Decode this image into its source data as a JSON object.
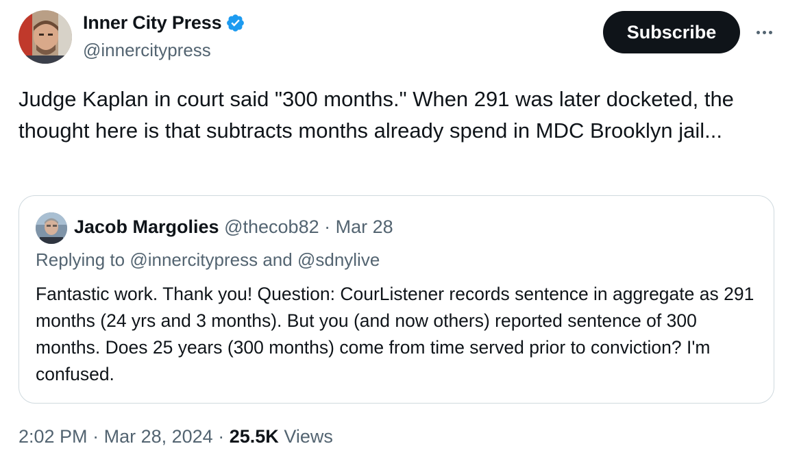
{
  "author": {
    "name": "Inner City Press",
    "handle": "@innercitypress",
    "verified": true
  },
  "actions": {
    "subscribe_label": "Subscribe",
    "more_icon": "more-horizontal-icon"
  },
  "tweet": {
    "text": "Judge Kaplan in court said \"300 months.\" When 291 was later docketed, the thought here is that subtracts months already spend in MDC Brooklyn jail..."
  },
  "quote": {
    "name": "Jacob Margolies",
    "handle": "@thecob82",
    "separator": "·",
    "date": "Mar 28",
    "replying_prefix": "Replying to",
    "replying_to": [
      "@innercitypress",
      "@sdnylive"
    ],
    "replying_joiner": "and",
    "text": "Fantastic work. Thank you! Question: CourListener records sentence in aggregate as 291 months (24 yrs and 3 months). But you (and now others) reported sentence of 300 months. Does 25 years (300 months) come from time served prior to conviction? I'm confused."
  },
  "footer": {
    "time": "2:02 PM",
    "separator": "·",
    "date": "Mar 28, 2024",
    "views_count": "25.5K",
    "views_label": "Views"
  },
  "colors": {
    "text_primary": "#0f1419",
    "text_secondary": "#536471",
    "verified_blue": "#1d9bf0",
    "button_bg": "#0f1419",
    "border": "#cfd9de"
  }
}
